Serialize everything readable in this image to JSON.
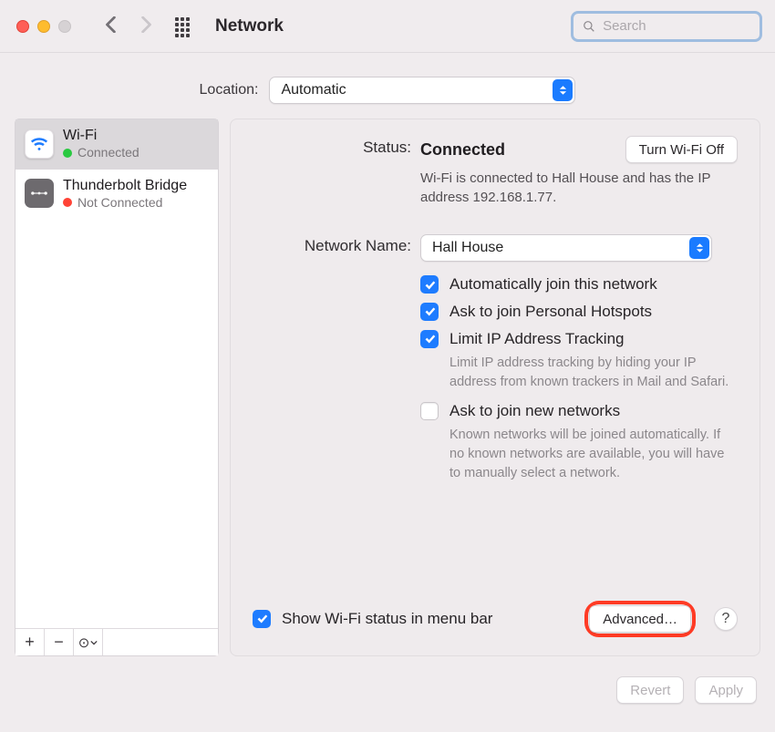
{
  "window": {
    "title": "Network",
    "search_placeholder": "Search"
  },
  "location": {
    "label": "Location:",
    "value": "Automatic"
  },
  "sidebar": {
    "interfaces": [
      {
        "name": "Wi-Fi",
        "status_label": "Connected",
        "status": "connected",
        "icon": "wifi"
      },
      {
        "name": "Thunderbolt Bridge",
        "status_label": "Not Connected",
        "status": "not_connected",
        "icon": "thunderbolt"
      }
    ],
    "footer": {
      "add_symbol": "+",
      "remove_symbol": "−",
      "menu_symbol": "⊙"
    }
  },
  "content": {
    "status_label": "Status:",
    "status_value": "Connected",
    "wifi_toggle": "Turn Wi-Fi Off",
    "status_detail": "Wi-Fi is connected to Hall House and has the IP address 192.168.1.77.",
    "network_name_label": "Network Name:",
    "network_name_value": "Hall House",
    "checks": {
      "auto_join": "Automatically join this network",
      "personal_hotspots": "Ask to join Personal Hotspots",
      "limit_tracking": "Limit IP Address Tracking",
      "limit_tracking_desc": "Limit IP address tracking by hiding your IP address from known trackers in Mail and Safari.",
      "ask_new": "Ask to join new networks",
      "ask_new_desc": "Known networks will be joined automatically. If no known networks are available, you will have to manually select a network."
    },
    "show_menubar": "Show Wi-Fi status in menu bar",
    "advanced": "Advanced…",
    "help": "?"
  },
  "footer": {
    "revert": "Revert",
    "apply": "Apply"
  }
}
